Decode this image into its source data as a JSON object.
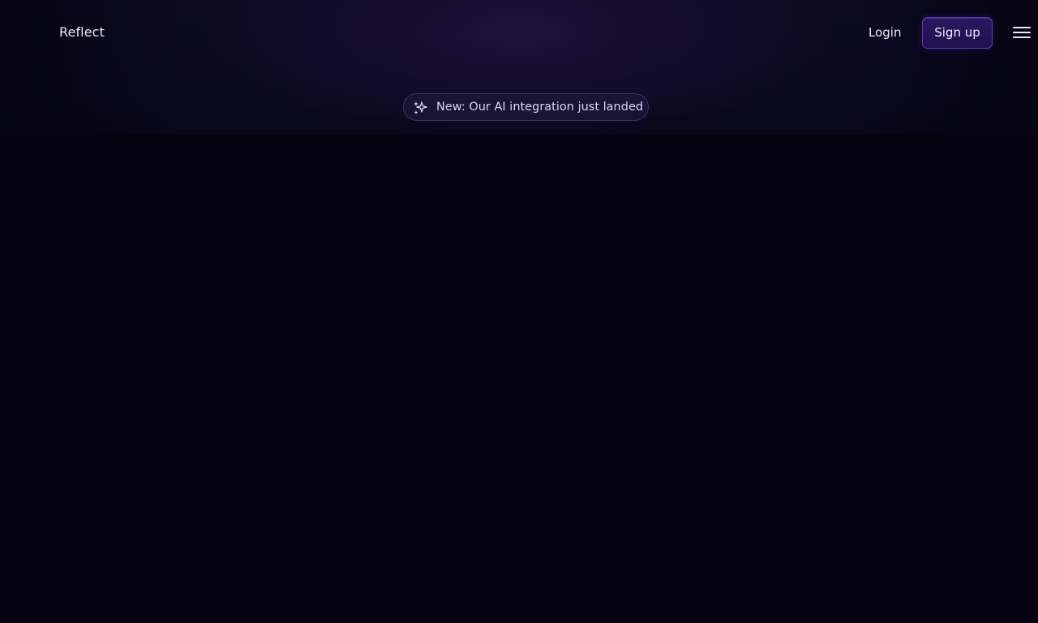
{
  "header": {
    "brand": "Reflect",
    "login_label": "Login",
    "signup_label": "Sign up",
    "menu_icon": "hamburger-menu-icon"
  },
  "announcement": {
    "icon": "sparkles-icon",
    "text": "New: Our AI integration just landed"
  },
  "colors": {
    "background": "#04030f",
    "accent": "#5b3bb3",
    "text": "#eceaf5"
  }
}
